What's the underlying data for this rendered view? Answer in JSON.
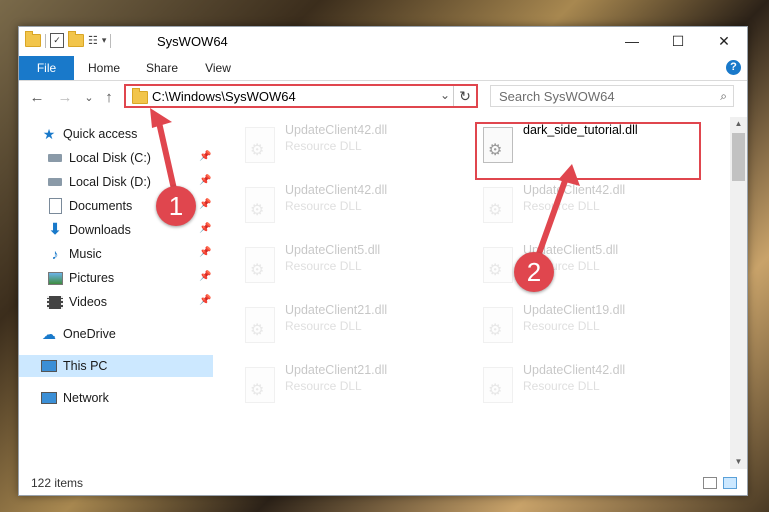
{
  "window": {
    "title": "SysWOW64",
    "minimize": "—",
    "maximize": "☐",
    "close": "✕"
  },
  "ribbon": {
    "tabs": [
      "File",
      "Home",
      "Share",
      "View"
    ],
    "help": "?"
  },
  "nav": {
    "back": "←",
    "forward": "→",
    "recent": "⌄",
    "up": "↑"
  },
  "address": {
    "path": "C:\\Windows\\SysWOW64",
    "refresh": "↻",
    "dropdown": "⌄"
  },
  "search": {
    "placeholder": "Search SysWOW64"
  },
  "sidebar": {
    "items": [
      {
        "label": "Quick access",
        "icon": "star-icon"
      },
      {
        "label": "Local Disk (C:)",
        "icon": "drive-icon"
      },
      {
        "label": "Local Disk (D:)",
        "icon": "drive-icon"
      },
      {
        "label": "Documents",
        "icon": "documents-icon"
      },
      {
        "label": "Downloads",
        "icon": "download-icon"
      },
      {
        "label": "Music",
        "icon": "music-icon"
      },
      {
        "label": "Pictures",
        "icon": "pictures-icon"
      },
      {
        "label": "Videos",
        "icon": "videos-icon"
      },
      {
        "label": "OneDrive",
        "icon": "cloud-icon"
      },
      {
        "label": "This PC",
        "icon": "computer-icon"
      },
      {
        "label": "Network",
        "icon": "network-icon"
      }
    ]
  },
  "files": [
    {
      "name": "UpdateClient42.dll",
      "type": "Resource DLL"
    },
    {
      "name": "dark_side_tutorial.dll",
      "type": ""
    },
    {
      "name": "UpdateClient42.dll",
      "type": "Resource DLL"
    },
    {
      "name": "UpdateClient42.dll",
      "type": "Resource DLL"
    },
    {
      "name": "UpdateClient5.dll",
      "type": "Resource DLL"
    },
    {
      "name": "UpdateClient5.dll",
      "type": "Resource DLL"
    },
    {
      "name": "UpdateClient21.dll",
      "type": "Resource DLL"
    },
    {
      "name": "UpdateClient19.dll",
      "type": "Resource DLL"
    },
    {
      "name": "UpdateClient21.dll",
      "type": "Resource DLL"
    },
    {
      "name": "UpdateClient42.dll",
      "type": "Resource DLL"
    }
  ],
  "status": {
    "count": "122 items"
  },
  "annotations": {
    "badge1": "1",
    "badge2": "2",
    "color": "#e0464e"
  }
}
